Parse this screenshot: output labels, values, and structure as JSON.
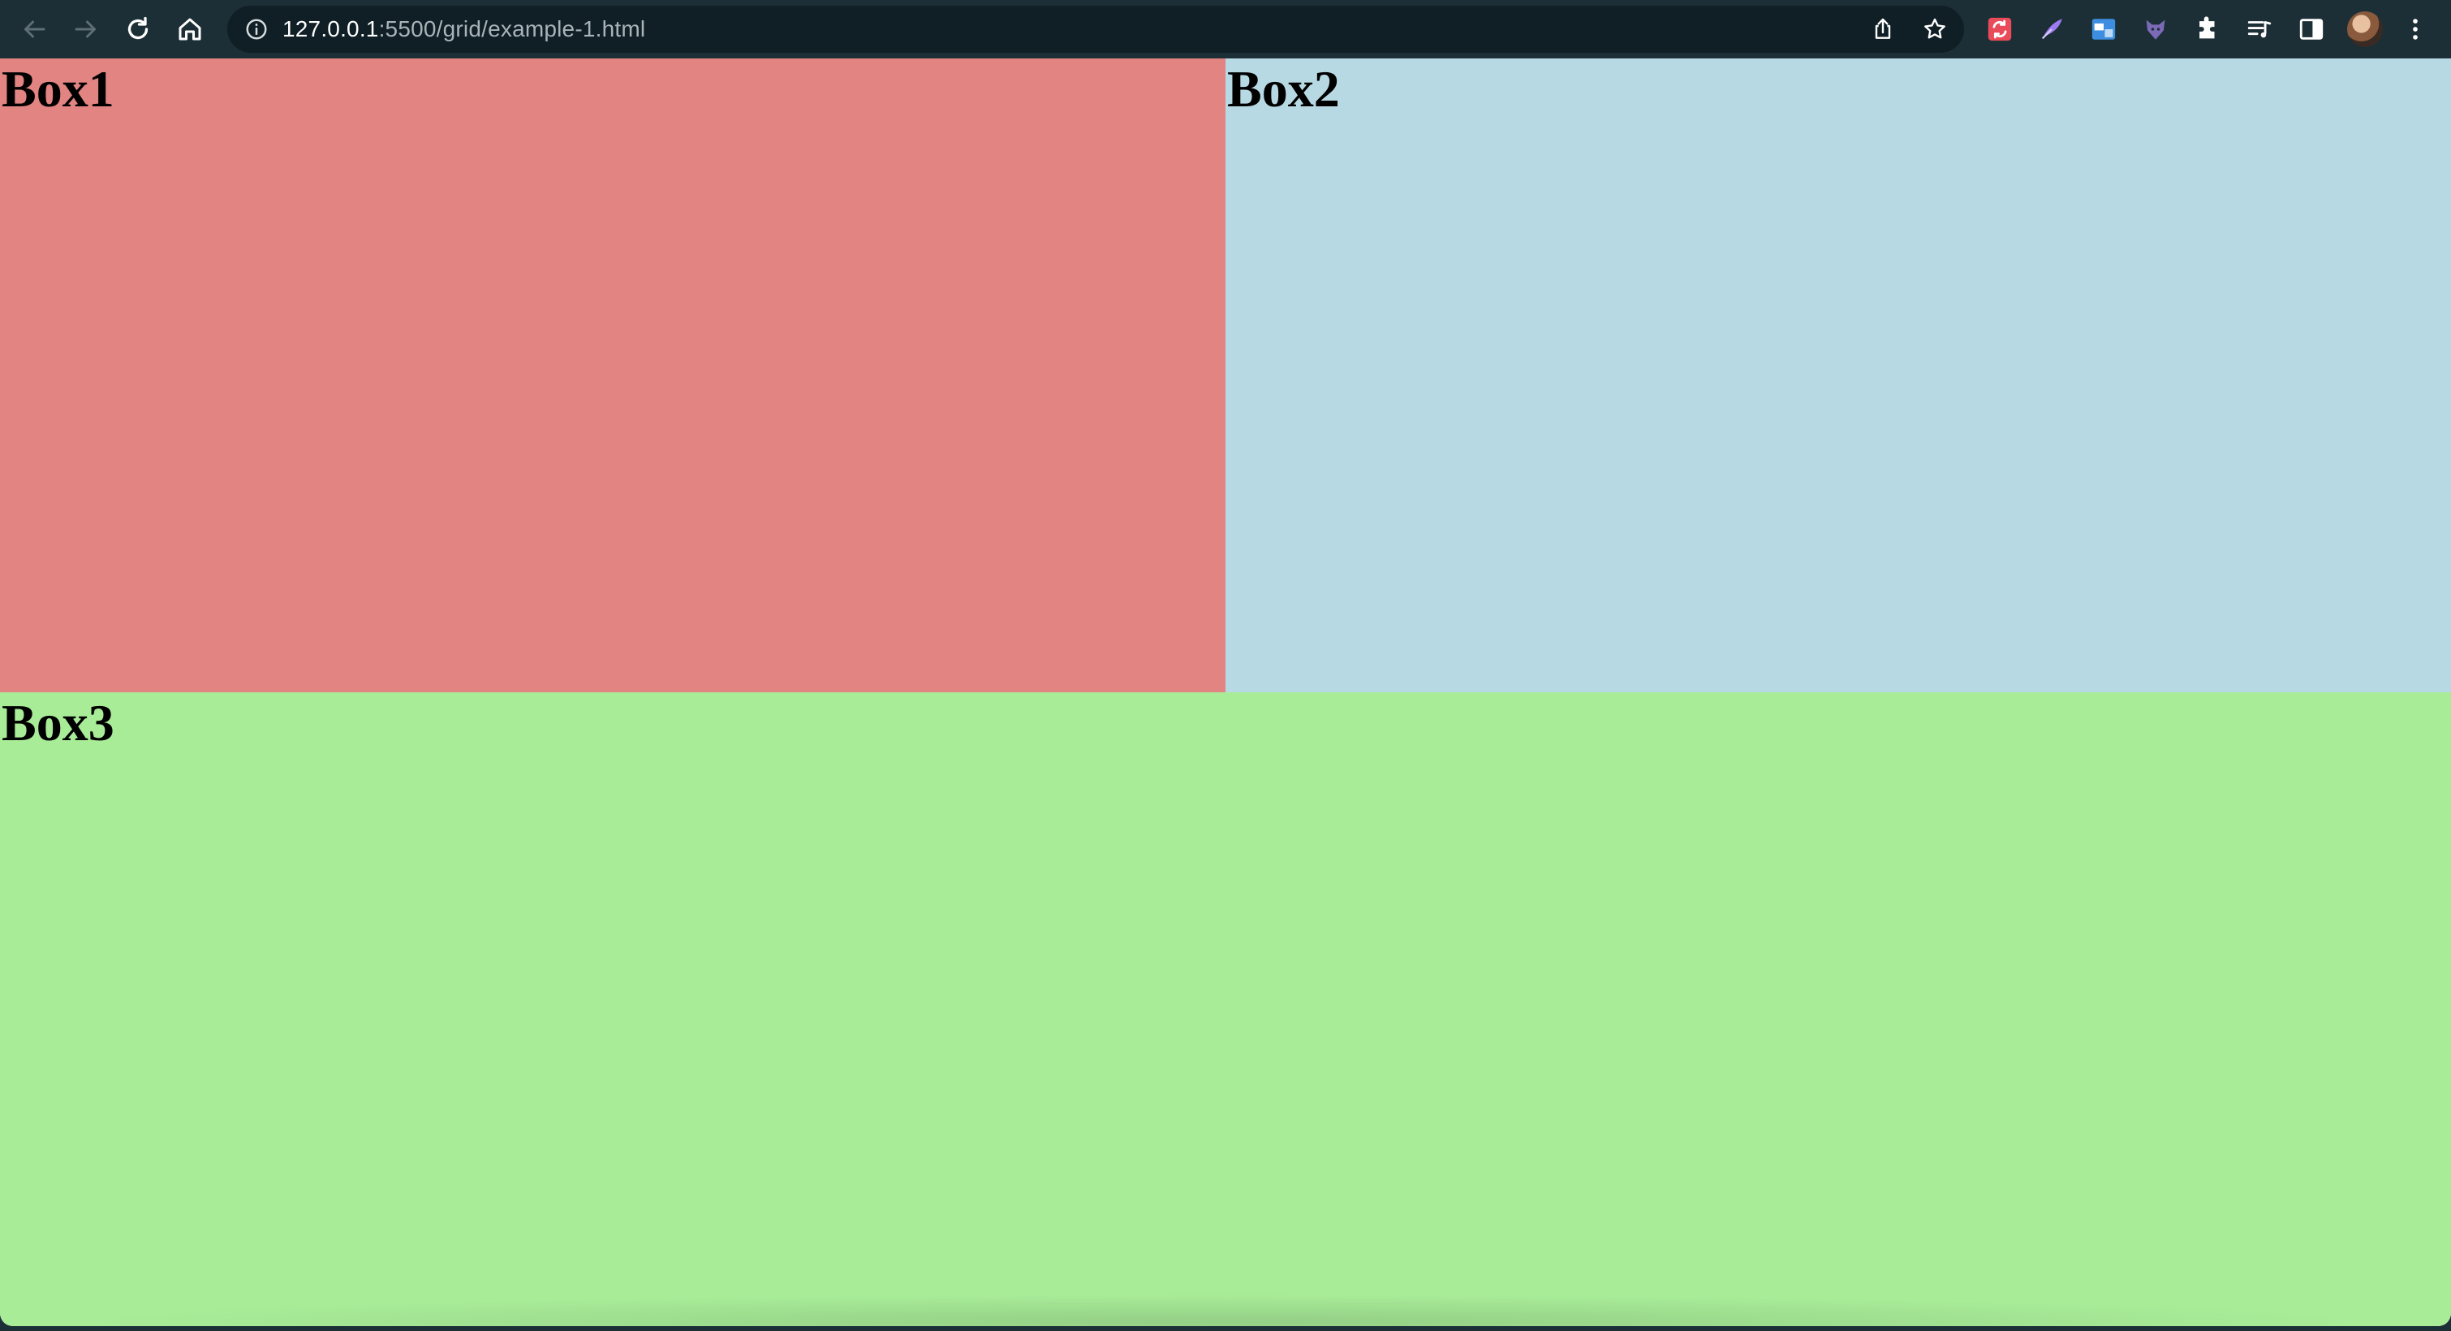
{
  "browser": {
    "url_host": "127.0.0.1",
    "url_path": ":5500/grid/example-1.html",
    "icons": {
      "back": "arrow-left-icon",
      "forward": "arrow-right-icon",
      "reload": "reload-icon",
      "home": "home-icon",
      "site_info": "info-icon",
      "share": "share-icon",
      "bookmark": "star-icon",
      "extensions": [
        "sync-extension-icon",
        "feather-extension-icon",
        "window-extension-icon",
        "fox-extension-icon",
        "puzzle-icon"
      ],
      "reading_list": "media-queue-icon",
      "side_panel": "side-panel-icon",
      "profile": "avatar",
      "menu": "kebab-menu-icon"
    }
  },
  "page": {
    "boxes": [
      {
        "label": "Box1",
        "color": "#e18482"
      },
      {
        "label": "Box2",
        "color": "#b7d9e4"
      },
      {
        "label": "Box3",
        "color": "#a8ec98"
      }
    ]
  }
}
